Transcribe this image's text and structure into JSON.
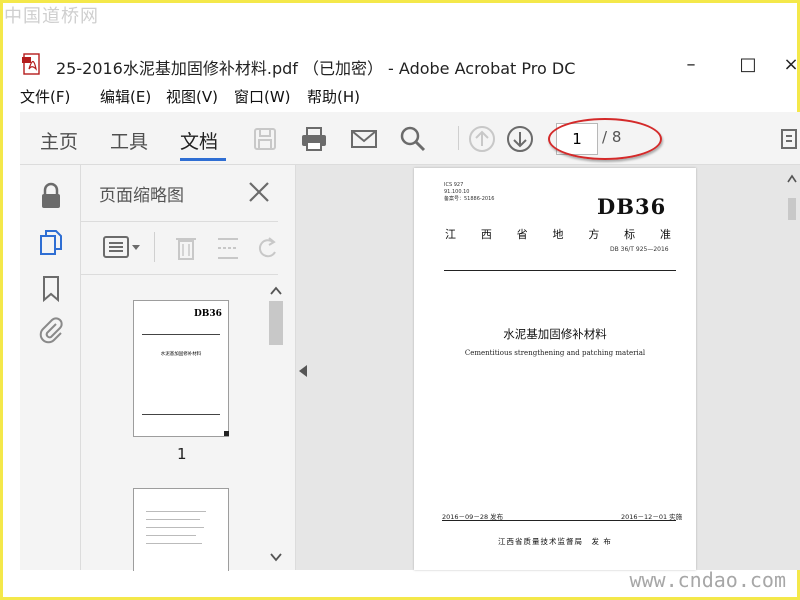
{
  "watermarks": {
    "top": "中国道桥网",
    "bottom": "www.cndao.com"
  },
  "window": {
    "title": "25-2016水泥基加固修补材料.pdf （已加密） - Adobe Acrobat Pro DC"
  },
  "menu": [
    "文件(F)",
    "编辑(E)",
    "视图(V)",
    "窗口(W)",
    "帮助(H)"
  ],
  "nav_tabs": [
    "主页",
    "工具",
    "文档"
  ],
  "active_tab": "文档",
  "navigation": {
    "current_page": "1",
    "total": "/ 8"
  },
  "thumbnails_panel": {
    "title": "页面缩略图",
    "page1_label": "1"
  },
  "document": {
    "meta_lines": [
      "ICS 927",
      "91.100.10",
      "备案号：51886-2016"
    ],
    "standard_mark": "DB36",
    "province": [
      "江",
      "西",
      "省",
      "地",
      "方",
      "标",
      "准"
    ],
    "code": "DB 36/T 925—2016",
    "title_cn": "水泥基加固修补材料",
    "title_en": "Cementitious strengthening and patching material",
    "issue_date": "2016－09－28 发布",
    "implement_date": "2016－12－01 实施",
    "publisher": "江西省质量技术监督局　发 布"
  },
  "colors": {
    "accent": "#2f6ed3",
    "annotation": "#d42a2a",
    "icon": "#6b6b6b",
    "icon_disabled": "#c8c8c8",
    "watermark_frame": "#f4e84a"
  }
}
